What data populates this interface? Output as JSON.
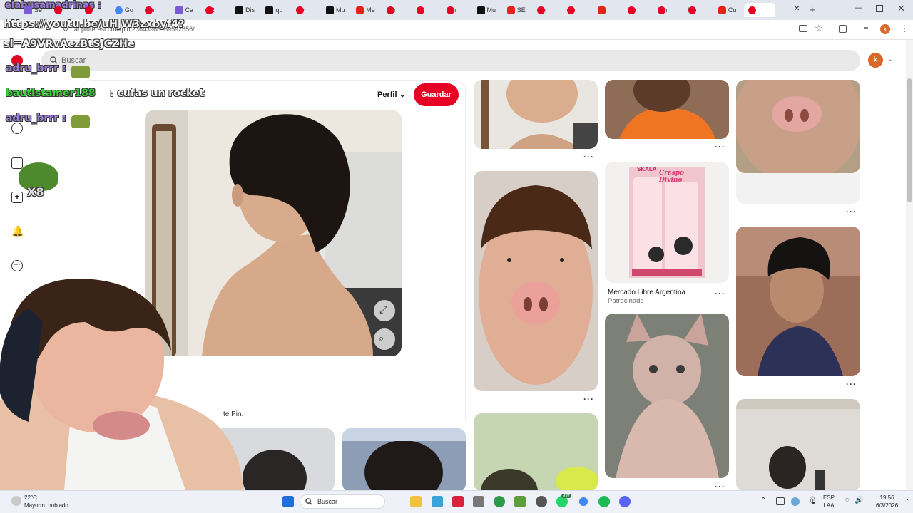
{
  "browser": {
    "tabs": [
      {
        "label": "Se",
        "icon": "cap"
      },
      {
        "label": "De",
        "icon": "pin"
      },
      {
        "label": "De",
        "icon": "pin"
      },
      {
        "label": "Go",
        "icon": "go"
      },
      {
        "label": "Pin",
        "icon": "pin"
      },
      {
        "label": "Ca",
        "icon": "cap"
      },
      {
        "label": "(12",
        "icon": "pin"
      },
      {
        "label": "Dis",
        "icon": "tt"
      },
      {
        "label": "qu",
        "icon": "tt"
      },
      {
        "label": "tov",
        "icon": "pin"
      },
      {
        "label": "Mu",
        "icon": "tt"
      },
      {
        "label": "Me",
        "icon": "yt"
      },
      {
        "label": "Mu",
        "icon": "pin"
      },
      {
        "label": "Di",
        "icon": "pin"
      },
      {
        "label": "Pin",
        "icon": "pin"
      },
      {
        "label": "Mu",
        "icon": "tt"
      },
      {
        "label": "SE",
        "icon": "yt"
      },
      {
        "label": "Pin",
        "icon": "pin"
      },
      {
        "label": "Pin",
        "icon": "pin"
      },
      {
        "label": "",
        "icon": "yt"
      },
      {
        "label": "Ro",
        "icon": "pin"
      },
      {
        "label": "Pin",
        "icon": "pin"
      },
      {
        "label": "Fu",
        "icon": "pin"
      },
      {
        "label": "Cu",
        "icon": "yt"
      },
      {
        "label": "(1",
        "icon": "pin"
      }
    ],
    "url": "ar.pinterest.com/pin/23643966..89592656/",
    "profile_initial": "k"
  },
  "pinterest": {
    "search_placeholder": "Buscar",
    "avatar_initial": "k",
    "profile_label": "Perfil",
    "save_label": "Guardar",
    "pin_text_fragment": "te Pin.",
    "ad_title": "Mercado Libre Argentina",
    "ad_sponsored": "Patrocinado",
    "product_brand": "SKALA",
    "product_name": "Crespo Divino"
  },
  "overlay": {
    "top_user": "elabusamadrinas :",
    "link_line1": "https://youtu.be/uHjW3zxbyf4?",
    "link_line2": "si=A9VRvAczBtSjCZHe",
    "chat": [
      {
        "user": "adru_brrr :",
        "message": ""
      },
      {
        "user": "bautistamer188",
        "message": ": cufas un rocket"
      },
      {
        "user": "adru_brrr :",
        "message": ""
      }
    ],
    "emote_count": "X8"
  },
  "taskbar": {
    "weather_temp": "22°C",
    "weather_desc": "Mayorm. nublado",
    "search_label": "Buscar",
    "lang_line1": "ESP",
    "lang_line2": "LAA",
    "time": "19:56",
    "date": "6/3/2026",
    "badge": "99+"
  }
}
